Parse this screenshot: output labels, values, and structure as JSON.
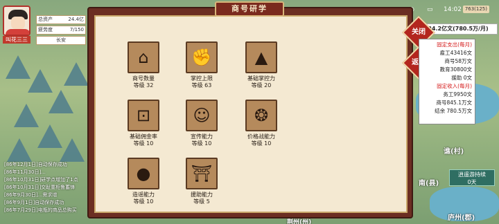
{
  "window": {
    "title": "商号研学"
  },
  "status": {
    "time": "14:02",
    "money_badge": "763(125)"
  },
  "player": {
    "name": "叫花三三",
    "stats": [
      {
        "label": "总资产",
        "value": "24.4亿"
      },
      {
        "label": "疲劳度",
        "value": "7/150"
      },
      {
        "label": "长安",
        "value": ""
      }
    ]
  },
  "research": [
    {
      "name": "商号数量",
      "level": "等级 32",
      "icon": "shop-icon"
    },
    {
      "name": "掌控上限",
      "level": "等级 63",
      "icon": "fist-icon"
    },
    {
      "name": "基础掌控力",
      "level": "等级 20",
      "icon": "raised-fist-icon"
    },
    {
      "name": "基础佣金率",
      "level": "等级 10",
      "icon": "coin-icon"
    },
    {
      "name": "宣传能力",
      "level": "等级 10",
      "icon": "messenger-icon"
    },
    {
      "name": "价格战能力",
      "level": "等级 10",
      "icon": "coins-icon"
    },
    {
      "name": "造谣能力",
      "level": "等级 10",
      "icon": "shadow-head-icon"
    },
    {
      "name": "援助能力",
      "level": "等级 5",
      "icon": "gate-icon"
    }
  ],
  "buttons": {
    "close": "关闭",
    "back": "返回"
  },
  "finance": {
    "total": "24.2亿文(780.5万/月)",
    "expense_title": "固定支出(每月)",
    "expenses": [
      "雇工43416文",
      "商号58万文",
      "教育30800文",
      "援助 0文"
    ],
    "income_title": "固定收入(每月)",
    "incomes": [
      "务工9950文",
      "商号845.1万文",
      "结余 780.5万文"
    ]
  },
  "log": [
    "[86年12月1日]自动保存成功",
    "[86年11月30日]...",
    "[86年10月31日]研学点增加了1点",
    "[86年10月31日]交趾重柜鲁蓄锋",
    "[86年9月30日]...需求增",
    "[86年9月1日]自动保存成功",
    "[86年7月29日]电瓶的商品总购买"
  ],
  "map": {
    "places": [
      "谯(村)",
      "南(县)",
      "庐州(郡)",
      "荆州(州)"
    ],
    "travel": {
      "label": "逍遥游持续",
      "value": "0天"
    }
  },
  "colors": {
    "panel_frame": "#6b2e22",
    "parchment": "#f4e9d2",
    "accent_red": "#b3261e"
  }
}
